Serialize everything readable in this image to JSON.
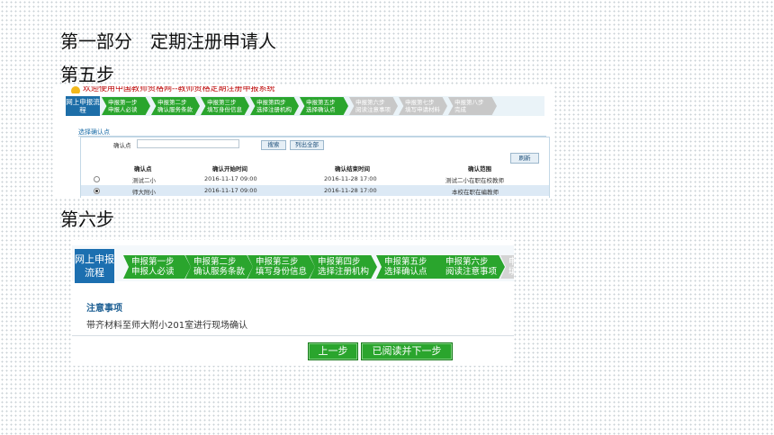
{
  "slide": {
    "part_title": "第一部分",
    "part_subtitle": "定期注册申请人",
    "step5_heading": "第五步",
    "step6_heading": "第六步"
  },
  "screenshot_step5": {
    "banner_text": "欢迎使用中国教师资格网--教师资格定期注册申报系统",
    "flow_label": "网上申报流程",
    "flow_steps": [
      {
        "line1": "申报第一步",
        "line2": "申报人必读"
      },
      {
        "line1": "申报第二步",
        "line2": "确认服务条款"
      },
      {
        "line1": "申报第三步",
        "line2": "填写身份信息"
      },
      {
        "line1": "申报第四步",
        "line2": "选择注册机构"
      },
      {
        "line1": "申报第五步",
        "line2": "选择确认点"
      },
      {
        "line1": "申报第六步",
        "line2": "阅读注意事项"
      },
      {
        "line1": "申报第七步",
        "line2": "填写申请材料"
      },
      {
        "line1": "申报第八步",
        "line2": "完成"
      }
    ],
    "section_title": "选择确认点",
    "search_label": "确认点",
    "search_value": "",
    "search_button": "搜索",
    "list_all_button": "列出全部",
    "refresh_button": "刷新",
    "table_headers": [
      "确认点",
      "确认开始时间",
      "确认结束时间",
      "确认范围"
    ],
    "rows": [
      {
        "selected": false,
        "point": "测试二小",
        "start": "2016-11-17 09:00",
        "end": "2016-11-28 17:00",
        "scope": "测试二小在职在校教师"
      },
      {
        "selected": true,
        "point": "师大附小",
        "start": "2016-11-17 09:00",
        "end": "2016-11-28 17:00",
        "scope": "本校在职在编教师"
      }
    ]
  },
  "screenshot_step6": {
    "flow_label": "网上申报流程",
    "flow_steps": [
      {
        "line1": "申报第一步",
        "line2": "申报人必读"
      },
      {
        "line1": "申报第二步",
        "line2": "确认服务条款"
      },
      {
        "line1": "申报第三步",
        "line2": "填写身份信息"
      },
      {
        "line1": "申报第四步",
        "line2": "选择注册机构"
      },
      {
        "line1": "申报第五步",
        "line2": "选择确认点"
      },
      {
        "line1": "申报第六步",
        "line2": "阅读注意事项"
      },
      {
        "line1": "申",
        "line2": "填"
      }
    ],
    "notice_title": "注意事项",
    "notice_body": "带齐材料至师大附小201室进行现场确认",
    "prev_button": "上一步",
    "next_button": "已阅读并下一步"
  },
  "colors": {
    "step_active": "#2aa52d",
    "step_inactive": "#c8c8c8",
    "flow_label_bg": "#1c6fb0",
    "banner_text": "#bb0000"
  }
}
